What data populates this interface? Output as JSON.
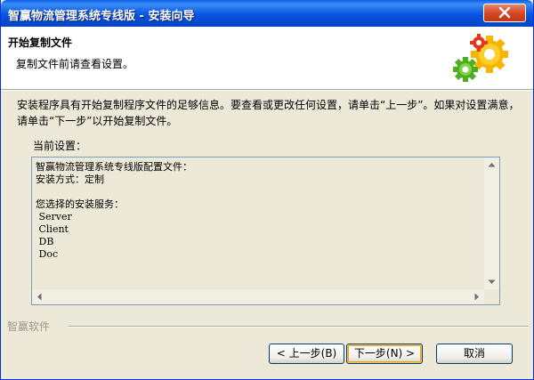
{
  "window": {
    "title": "智赢物流管理系统专线版 - 安装向导"
  },
  "header": {
    "title": "开始复制文件",
    "subtitle": "复制文件前请查看设置。",
    "icon": "gears-icon"
  },
  "body": {
    "intro": "安装程序具有开始复制程序文件的足够信息。要查看或更改任何设置，请单击“上一步”。如果对设置满意，请单击“下一步”以开始复制文件。",
    "current_settings_label": "当前设置：",
    "settings_lines": [
      "智赢物流管理系统专线版配置文件：",
      "安装方式：定制",
      "",
      "您选择的安装服务：",
      " Server",
      " Client",
      " DB",
      " Doc"
    ]
  },
  "footer": {
    "brand": "智赢软件",
    "back_label": "< 上一步(B)",
    "next_label": "下一步(N) >",
    "cancel_label": "取消"
  },
  "colors": {
    "titlebar": "#0a5fe8",
    "window_bg": "#ece9d8",
    "close_button": "#d2421c"
  }
}
